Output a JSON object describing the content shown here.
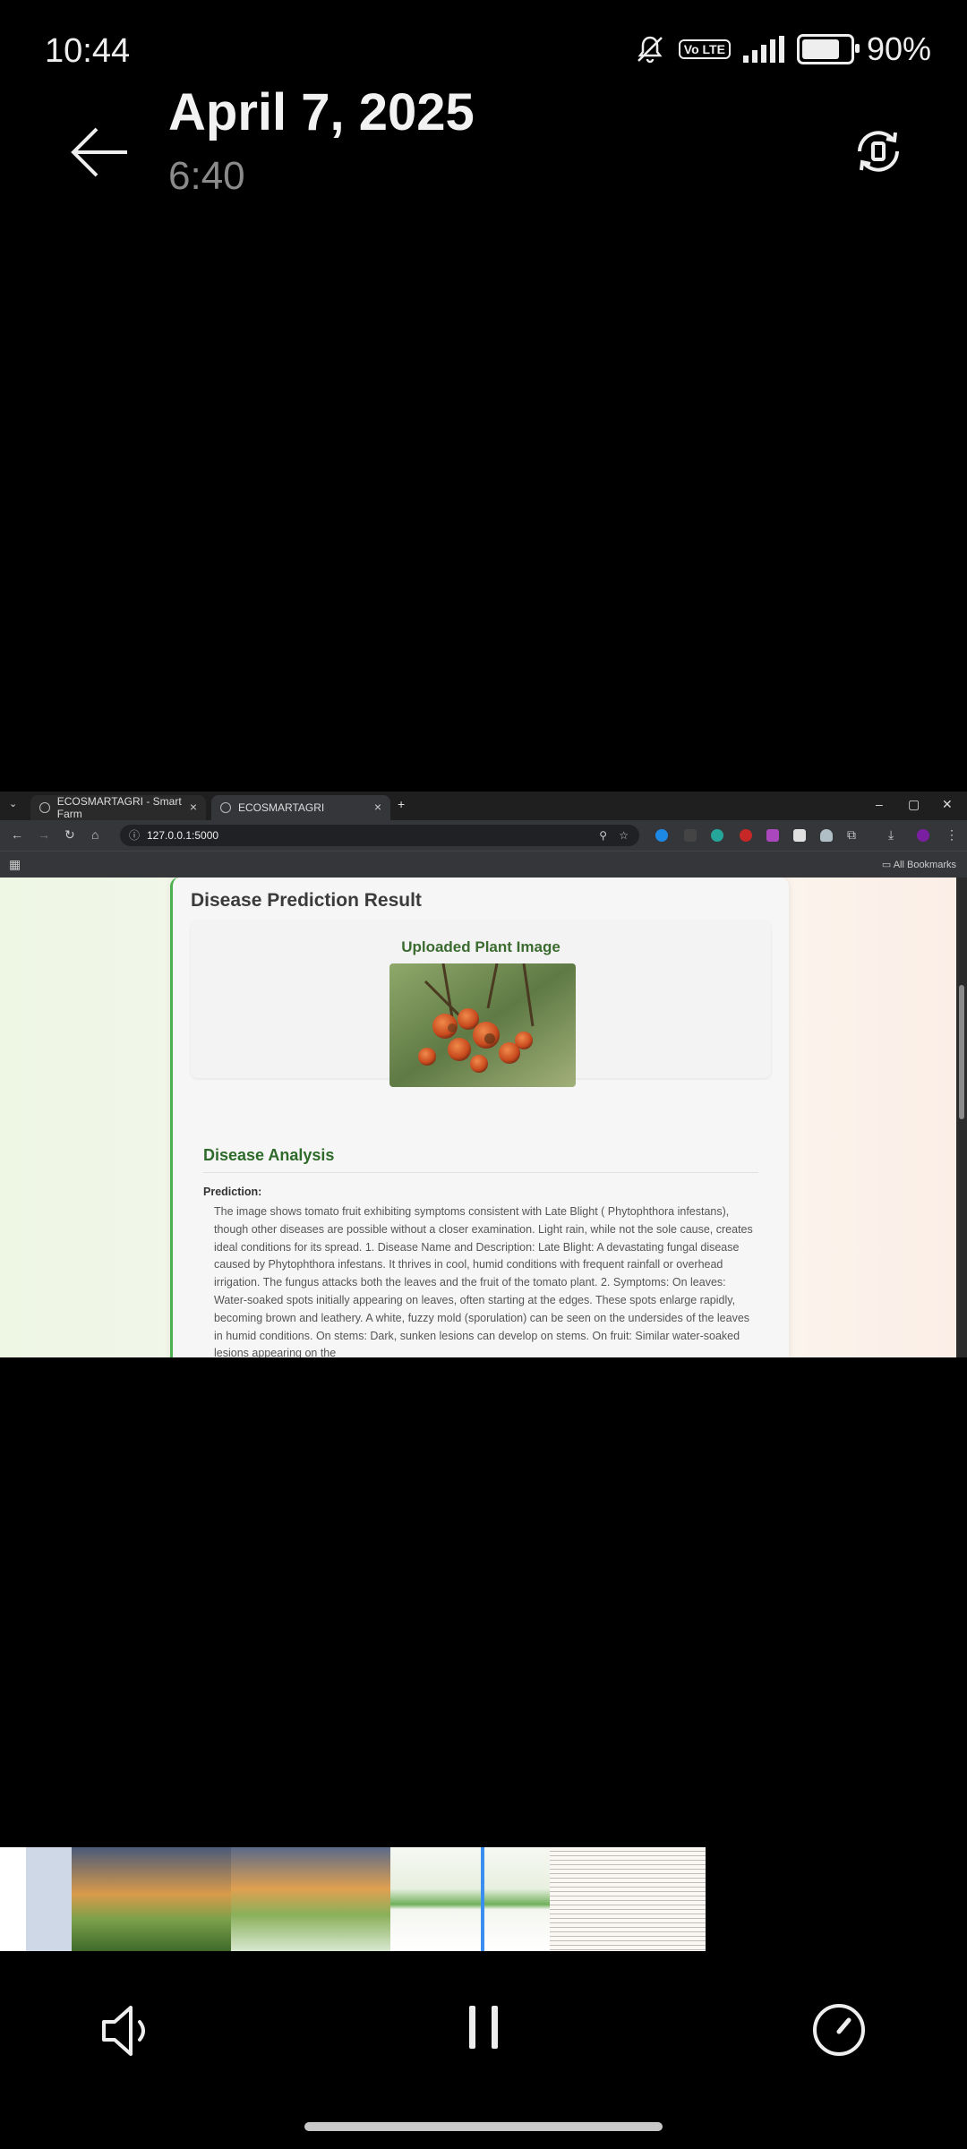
{
  "status_bar": {
    "time": "10:44",
    "network": "Vo LTE",
    "battery_text": "90%",
    "battery_level": 0.9
  },
  "header": {
    "date": "April 7, 2025",
    "time": "6:40",
    "icons": [
      "back-arrow-icon",
      "rotate-icon"
    ]
  },
  "browser": {
    "tabs": [
      {
        "label": "ECOSMARTAGRI - Smart Farm"
      },
      {
        "label": "ECOSMARTAGRI"
      }
    ],
    "url": "127.0.0.1:5000",
    "bookmarks_label": "All Bookmarks",
    "page": {
      "title": "Disease Prediction Result",
      "image_section_title": "Uploaded Plant Image",
      "analysis_title": "Disease Analysis",
      "prediction_label": "Prediction:",
      "prediction_text": "The image shows tomato fruit exhibiting symptoms consistent with Late Blight ( Phytophthora infestans), though other diseases are possible without a closer examination. Light rain, while not the sole cause, creates ideal conditions for its spread. 1. Disease Name and Description: Late Blight: A devastating fungal disease caused by Phytophthora infestans. It thrives in cool, humid conditions with frequent rainfall or overhead irrigation. The fungus attacks both the leaves and the fruit of the tomato plant. 2. Symptoms: On leaves: Water-soaked spots initially appearing on leaves, often starting at the edges. These spots enlarge rapidly, becoming brown and leathery. A white, fuzzy mold (sporulation) can be seen on the undersides of the leaves in humid conditions. On stems: Dark, sunken lesions can develop on stems. On fruit: Similar water-soaked lesions appearing on the"
    }
  },
  "player": {
    "icons": [
      "volume-icon",
      "pause-icon",
      "speed-icon"
    ]
  },
  "colors": {
    "accent_green": "#4caf50",
    "heading_green": "#2e6b2a",
    "playhead_blue": "#3a8eef"
  }
}
